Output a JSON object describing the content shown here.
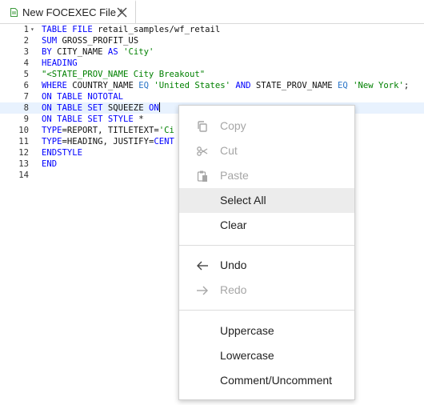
{
  "tab": {
    "title": "New FOCEXEC File *"
  },
  "editor": {
    "lines": [
      {
        "no": "1",
        "tokens": [
          {
            "c": "kw",
            "t": "TABLE FILE "
          },
          {
            "c": "txt",
            "t": "retail_samples/wf_retail"
          }
        ]
      },
      {
        "no": "2",
        "tokens": [
          {
            "c": "kw",
            "t": "SUM "
          },
          {
            "c": "txt",
            "t": "GROSS_PROFIT_US"
          }
        ]
      },
      {
        "no": "3",
        "tokens": [
          {
            "c": "kw",
            "t": "BY "
          },
          {
            "c": "txt",
            "t": "CITY_NAME "
          },
          {
            "c": "kw",
            "t": "AS "
          },
          {
            "c": "str",
            "t": "'City'"
          }
        ]
      },
      {
        "no": "4",
        "tokens": [
          {
            "c": "kw",
            "t": "HEADING"
          }
        ]
      },
      {
        "no": "5",
        "tokens": [
          {
            "c": "str",
            "t": "\"<STATE_PROV_NAME City Breakout\""
          }
        ]
      },
      {
        "no": "6",
        "tokens": [
          {
            "c": "kw",
            "t": "WHERE "
          },
          {
            "c": "txt",
            "t": "COUNTRY_NAME "
          },
          {
            "c": "op",
            "t": "EQ "
          },
          {
            "c": "str",
            "t": "'United States' "
          },
          {
            "c": "kw",
            "t": "AND "
          },
          {
            "c": "txt",
            "t": "STATE_PROV_NAME "
          },
          {
            "c": "op",
            "t": "EQ "
          },
          {
            "c": "str",
            "t": "'New York'"
          },
          {
            "c": "txt",
            "t": ";"
          }
        ]
      },
      {
        "no": "7",
        "tokens": [
          {
            "c": "kw",
            "t": "ON TABLE NOTOTAL"
          }
        ]
      },
      {
        "no": "8",
        "tokens": [
          {
            "c": "kw",
            "t": "ON TABLE SET "
          },
          {
            "c": "txt",
            "t": "SQUEEZE "
          },
          {
            "c": "kw",
            "t": "ON"
          }
        ]
      },
      {
        "no": "9",
        "tokens": [
          {
            "c": "kw",
            "t": "ON TABLE SET STYLE "
          },
          {
            "c": "txt",
            "t": "*"
          }
        ]
      },
      {
        "no": "10",
        "tokens": [
          {
            "c": "kw",
            "t": "TYPE"
          },
          {
            "c": "txt",
            "t": "=REPORT, TITLETEXT="
          },
          {
            "c": "str",
            "t": "'Ci"
          }
        ]
      },
      {
        "no": "11",
        "tokens": [
          {
            "c": "kw",
            "t": "TYPE"
          },
          {
            "c": "txt",
            "t": "=HEADING, JUSTIFY="
          },
          {
            "c": "kw",
            "t": "CENT"
          }
        ]
      },
      {
        "no": "12",
        "tokens": [
          {
            "c": "kw",
            "t": "ENDSTYLE"
          }
        ]
      },
      {
        "no": "13",
        "tokens": [
          {
            "c": "kw",
            "t": "END"
          }
        ]
      },
      {
        "no": "14",
        "tokens": []
      }
    ]
  },
  "context_menu": {
    "copy": "Copy",
    "cut": "Cut",
    "paste": "Paste",
    "select_all": "Select All",
    "clear": "Clear",
    "undo": "Undo",
    "redo": "Redo",
    "uppercase": "Uppercase",
    "lowercase": "Lowercase",
    "comment": "Comment/Uncomment"
  },
  "colors": {
    "keyword": "#0000ff",
    "string": "#008000",
    "operator": "#2a75c8",
    "active_line": "#e8f2fe",
    "menu_highlight": "#ececec",
    "disabled_text": "#a6a6a6"
  }
}
